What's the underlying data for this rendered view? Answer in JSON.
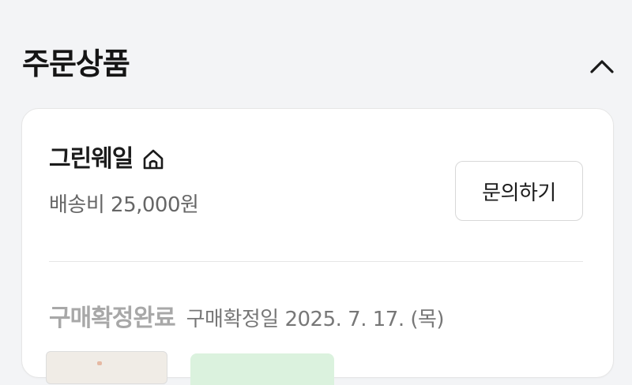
{
  "section": {
    "title": "주문상품",
    "collapse_icon": "chevron-up-icon"
  },
  "seller": {
    "name": "그린웨일",
    "home_icon": "home-icon",
    "shipping_fee": "배송비 25,000원",
    "inquiry_label": "문의하기"
  },
  "order": {
    "status": "구매확정완료",
    "confirm_date": "구매확정일 2025. 7. 17. (목)"
  },
  "colors": {
    "background": "#f3f4f6",
    "card": "#ffffff",
    "status_gray": "#a8a8a8",
    "badge_green": "#dbf2de"
  }
}
